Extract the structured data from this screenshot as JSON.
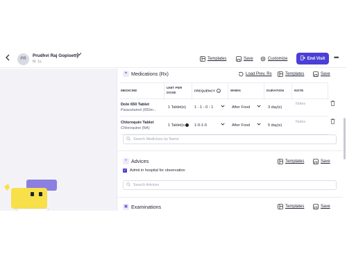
{
  "header": {
    "back_icon": "chevron-left-icon",
    "avatar_initials": "PR",
    "patient_name": "Prudhvi Raj Gopisetty",
    "patient_meta": "M, 1y,",
    "templates_label": "Templates",
    "save_label": "Save",
    "customize_label": "Customize",
    "end_visit_label": "End Visit",
    "more_label": "•••"
  },
  "medications": {
    "title": "Medications (Rx)",
    "load_prev_label": "Load Prev. Rx",
    "templates_label": "Templates",
    "save_label": "Save",
    "columns": [
      "MEDICINE",
      "UNIT PER DOSE",
      "FREQUENCY",
      "WHEN",
      "DURATION",
      "NOTE"
    ],
    "rows": [
      {
        "name": "Dolo 650 Tablet",
        "generic": "Paracetamol (650m...",
        "unit": "1 Tablet(s)",
        "frequency": "1 - 1 - 0 - 1",
        "when": "After Food",
        "duration": "3 day(s)",
        "note_placeholder": "Notes"
      },
      {
        "name": "Chloroquin Tablet",
        "generic": "Chloroquine (NA)",
        "unit": "1 Tablet(s",
        "frequency": "1-0-1-0",
        "when": "After Food",
        "duration": "5 day(s)",
        "note_placeholder": "Notes"
      }
    ],
    "search_placeholder": "Search Medicines by Name"
  },
  "advices": {
    "title": "Advices",
    "templates_label": "Templates",
    "save_label": "Save",
    "checked_item": "Admit in hospital for observation",
    "search_placeholder": "Search Advices"
  },
  "examinations": {
    "title": "Examinations",
    "templates_label": "Templates",
    "save_label": "Save"
  },
  "colors": {
    "accent": "#4b3fd8",
    "left_pane_bg": "#f3f3f7",
    "mascot_yellow": "#f7e04a",
    "mascot_purple": "#8b7fe0"
  }
}
